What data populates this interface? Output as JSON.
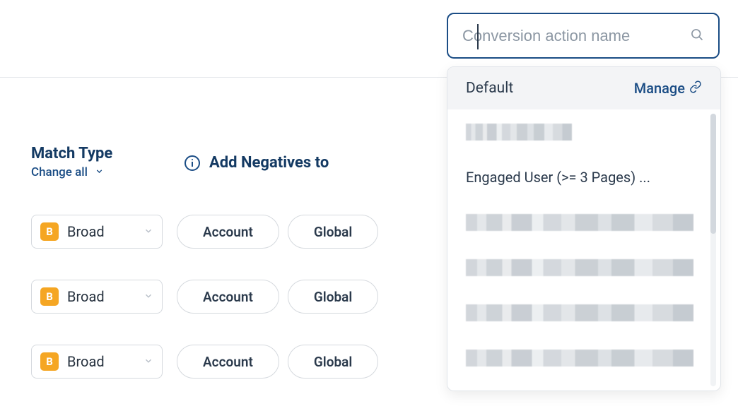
{
  "headers": {
    "match_type": "Match Type",
    "change_all": "Change all",
    "add_negatives": "Add Negatives to"
  },
  "match_badge": "B",
  "rows": [
    {
      "match_label": "Broad",
      "account_label": "Account",
      "global_label": "Global"
    },
    {
      "match_label": "Broad",
      "account_label": "Account",
      "global_label": "Global"
    },
    {
      "match_label": "Broad",
      "account_label": "Account",
      "global_label": "Global"
    }
  ],
  "search": {
    "placeholder": "Conversion action name",
    "value": ""
  },
  "dropdown": {
    "group_title": "Default",
    "manage_label": "Manage",
    "items": [
      {
        "type": "blurred"
      },
      {
        "type": "text",
        "label": "Engaged User (>= 3 Pages) ..."
      },
      {
        "type": "blurred"
      },
      {
        "type": "blurred"
      },
      {
        "type": "blurred"
      },
      {
        "type": "blurred"
      },
      {
        "type": "blurred"
      }
    ]
  }
}
